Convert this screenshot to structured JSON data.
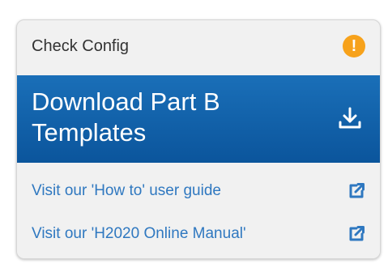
{
  "header": {
    "title": "Check Config",
    "status_icon": "warning-icon",
    "status_glyph": "!",
    "status_color": "#f7a21b"
  },
  "download": {
    "label": "Download Part B Templates",
    "icon": "download-icon",
    "background": "#0b5fa8"
  },
  "links": [
    {
      "label": "Visit our 'How to' user guide",
      "icon": "external-link-icon"
    },
    {
      "label": "Visit our 'H2020 Online Manual'",
      "icon": "external-link-icon"
    }
  ],
  "colors": {
    "link": "#2f78c0",
    "panel_bg": "#f1f1f1"
  }
}
